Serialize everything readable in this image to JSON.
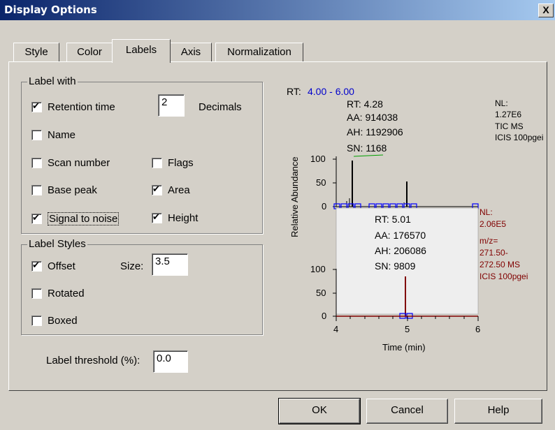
{
  "window": {
    "title": "Display Options",
    "close_label": "X"
  },
  "tabs": [
    {
      "label": "Style"
    },
    {
      "label": "Color"
    },
    {
      "label": "Labels"
    },
    {
      "label": "Axis"
    },
    {
      "label": "Normalization"
    }
  ],
  "label_with": {
    "legend": "Label with",
    "retention_time": {
      "label": "Retention time",
      "checked": true
    },
    "decimals_value": "2",
    "decimals_label": "Decimals",
    "name": {
      "label": "Name",
      "checked": false
    },
    "scan_number": {
      "label": "Scan number",
      "checked": false
    },
    "flags": {
      "label": "Flags",
      "checked": false
    },
    "base_peak": {
      "label": "Base peak",
      "checked": false
    },
    "area": {
      "label": "Area",
      "checked": true
    },
    "signal_to_noise": {
      "label": "Signal to noise",
      "checked": true
    },
    "height": {
      "label": "Height",
      "checked": true
    }
  },
  "label_styles": {
    "legend": "Label Styles",
    "offset": {
      "label": "Offset",
      "checked": true
    },
    "size_label": "Size:",
    "size_value": "3.5",
    "rotated": {
      "label": "Rotated",
      "checked": false
    },
    "boxed": {
      "label": "Boxed",
      "checked": false
    }
  },
  "threshold": {
    "label": "Label threshold (%):",
    "value": "0.0"
  },
  "buttons": {
    "ok": "OK",
    "cancel": "Cancel",
    "help": "Help"
  },
  "preview": {
    "rt_range_prefix": "RT: ",
    "rt_range": "4.00 - 6.00",
    "top_peak": [
      "RT: 4.28",
      "AA: 914038",
      "AH: 1192906",
      "SN: 1168"
    ],
    "top_info": [
      "NL:",
      "1.27E6",
      "TIC MS",
      "ICIS 100pgei"
    ],
    "bottom_peak": [
      "RT: 5.01",
      "AA: 176570",
      "AH: 206086",
      "SN: 9809"
    ],
    "bottom_info": [
      "NL:",
      "2.06E5",
      "m/z=",
      "271.50-",
      "272.50 MS",
      "ICIS 100pgei"
    ],
    "ylabel": "Relative Abundance",
    "xlabel": "Time (min)",
    "y_ticks": [
      "100",
      "50",
      "0"
    ],
    "x_ticks": [
      "4",
      "5",
      "6"
    ],
    "colors": {
      "rt_range": "#0000cc",
      "bottom": "#800000",
      "markers": "#0000ff"
    }
  }
}
